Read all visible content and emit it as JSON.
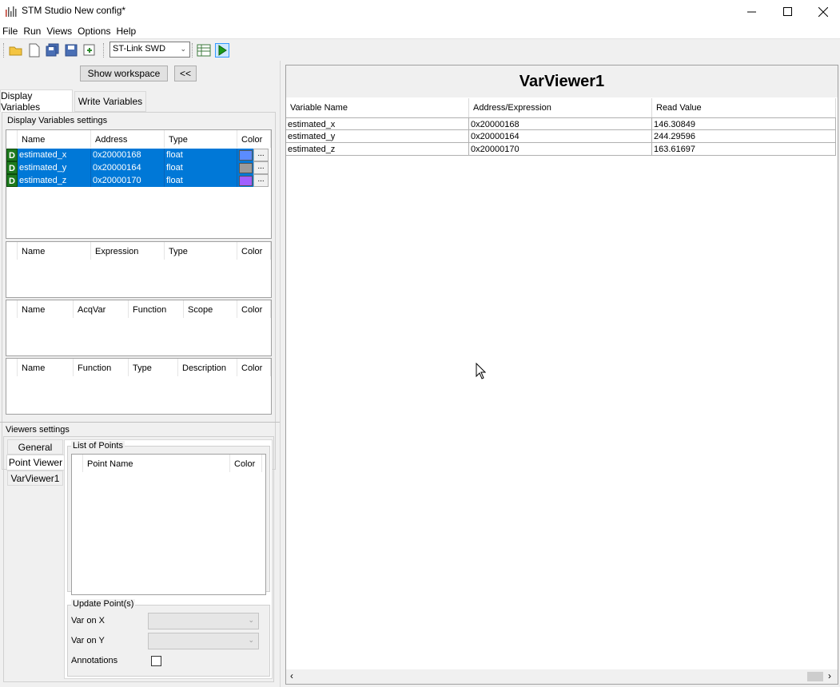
{
  "window": {
    "title": "STM Studio New config*"
  },
  "menu": [
    "File",
    "Run",
    "Views",
    "Options",
    "Help"
  ],
  "toolbar": {
    "probe": "ST-Link SWD"
  },
  "left": {
    "show_workspace": "Show workspace",
    "collapse": "<<",
    "tabs": [
      "Display Variables",
      "Write Variables"
    ],
    "dv_settings": "Display Variables settings",
    "var_table": {
      "headers": [
        "Name",
        "Address",
        "Type",
        "Color"
      ],
      "rows": [
        {
          "badge": "D",
          "name": "estimated_x",
          "address": "0x20000168",
          "type": "float",
          "color": "#5b8cff",
          "dots": "..."
        },
        {
          "badge": "D",
          "name": "estimated_y",
          "address": "0x20000164",
          "type": "float",
          "color": "#9a9a9a",
          "dots": "..."
        },
        {
          "badge": "D",
          "name": "estimated_z",
          "address": "0x20000170",
          "type": "float",
          "color": "#a060ff",
          "dots": "..."
        }
      ]
    },
    "expr_table": {
      "headers": [
        "Name",
        "Expression",
        "Type",
        "Color"
      ]
    },
    "func_table": {
      "headers": [
        "Name",
        "AcqVar",
        "Function",
        "Scope",
        "Color"
      ]
    },
    "desc_table": {
      "headers": [
        "Name",
        "Function",
        "Type",
        "Description",
        "Color"
      ]
    },
    "viewers_settings": "Viewers settings",
    "viewer_tabs": [
      "General",
      "Point Viewer",
      "VarViewer1"
    ],
    "list_of_points": "List of Points",
    "points_headers": [
      "Point Name",
      "Color"
    ],
    "update_points": "Update Point(s)",
    "var_on_x": "Var on X",
    "var_on_y": "Var on Y",
    "annotations": "Annotations"
  },
  "viewer": {
    "title": "VarViewer1",
    "headers": [
      "Variable Name",
      "Address/Expression",
      "Read Value"
    ],
    "rows": [
      {
        "name": "estimated_x",
        "address": "0x20000168",
        "value": "146.30849"
      },
      {
        "name": "estimated_y",
        "address": "0x20000164",
        "value": "244.29596"
      },
      {
        "name": "estimated_z",
        "address": "0x20000170",
        "value": "163.61697"
      }
    ]
  }
}
